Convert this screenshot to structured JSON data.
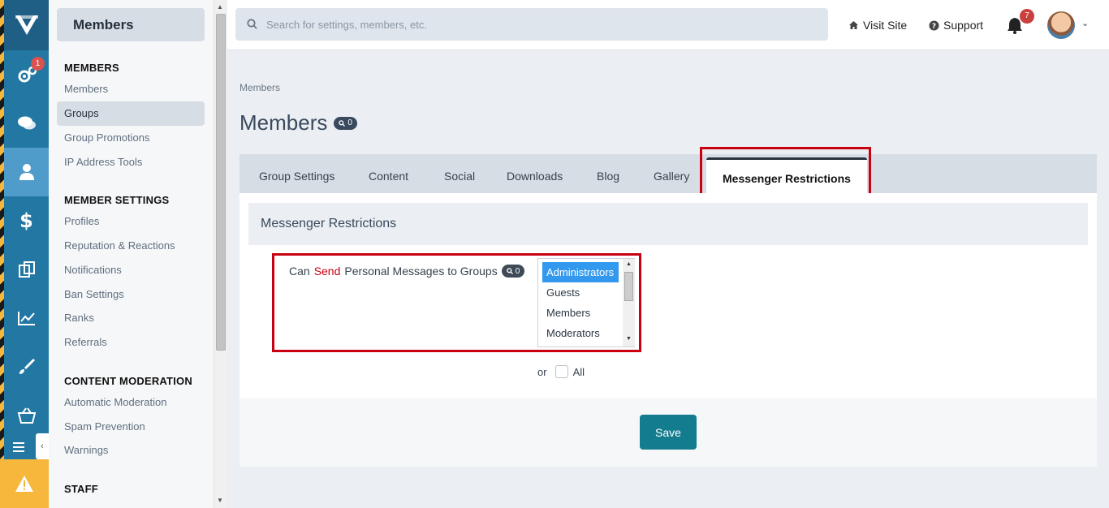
{
  "rail": {
    "notify_badge": "1"
  },
  "sidebar": {
    "title": "Members",
    "sections": [
      {
        "label": "MEMBERS",
        "items": [
          "Members",
          "Groups",
          "Group Promotions",
          "IP Address Tools"
        ]
      },
      {
        "label": "MEMBER SETTINGS",
        "items": [
          "Profiles",
          "Reputation & Reactions",
          "Notifications",
          "Ban Settings",
          "Ranks",
          "Referrals"
        ]
      },
      {
        "label": "CONTENT MODERATION",
        "items": [
          "Automatic Moderation",
          "Spam Prevention",
          "Warnings"
        ]
      },
      {
        "label": "STAFF",
        "items": []
      }
    ],
    "active_item": "Groups"
  },
  "topbar": {
    "search_placeholder": "Search for settings, members, etc.",
    "visit_site": "Visit Site",
    "support": "Support",
    "notifications_count": "7"
  },
  "breadcrumb": "Members",
  "page_title": "Members",
  "page_title_badge": "0",
  "tabs": [
    "Group Settings",
    "Content",
    "Social",
    "Downloads",
    "Blog",
    "Gallery",
    "Messenger Restrictions"
  ],
  "active_tab": "Messenger Restrictions",
  "panel": {
    "heading": "Messenger Restrictions",
    "field_label_pre": "Can",
    "field_label_red": "Send",
    "field_label_post": "Personal Messages to Groups",
    "field_badge": "0",
    "groups": [
      "Administrators",
      "Guests",
      "Members",
      "Moderators"
    ],
    "selected_group": "Administrators",
    "or_label": "or",
    "all_label": "All"
  },
  "save_label": "Save",
  "colors": {
    "accent": "#147c8f",
    "highlight_border": "#c8000f",
    "rail": "#2277a3"
  }
}
